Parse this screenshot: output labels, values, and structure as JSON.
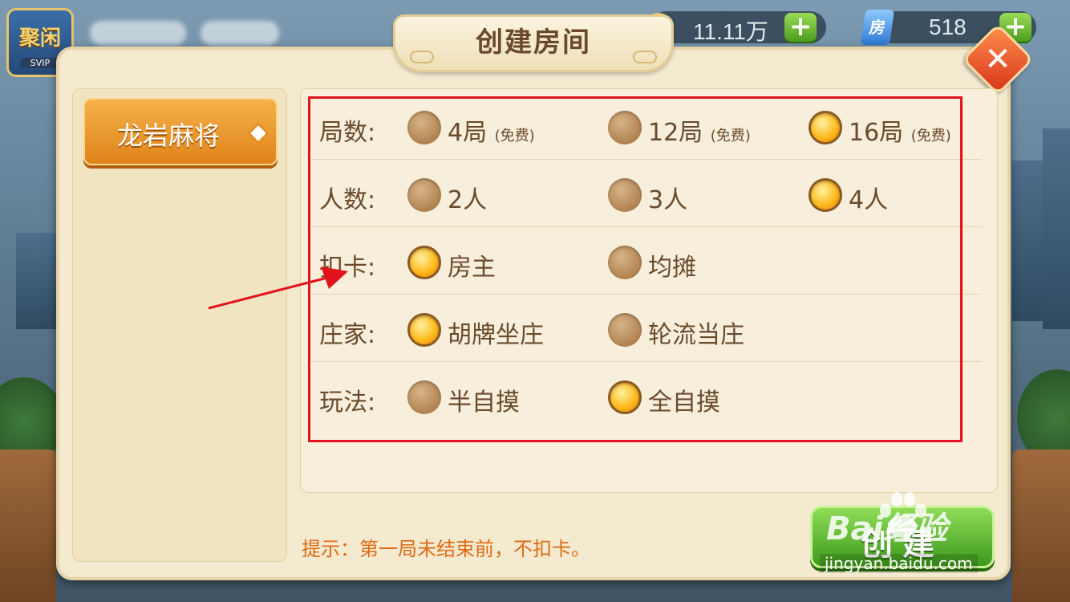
{
  "top_bar": {
    "logo_text": "聚闲",
    "logo_sub": "SVIP",
    "coins": "11.11万",
    "cards_icon_text": "房",
    "cards": "518",
    "plus_label": "+"
  },
  "dialog": {
    "title": "创建房间",
    "close_label": "✕"
  },
  "game_list": [
    {
      "label": "龙岩麻将",
      "selected": true
    }
  ],
  "rows": [
    {
      "label": "局数:",
      "options": [
        {
          "label": "4局",
          "note": "(免费)",
          "selected": false
        },
        {
          "label": "12局",
          "note": "(免费)",
          "selected": false
        },
        {
          "label": "16局",
          "note": "(免费)",
          "selected": true
        }
      ]
    },
    {
      "label": "人数:",
      "options": [
        {
          "label": "2人",
          "selected": false
        },
        {
          "label": "3人",
          "selected": false
        },
        {
          "label": "4人",
          "selected": true
        }
      ]
    },
    {
      "label": "扣卡:",
      "options": [
        {
          "label": "房主",
          "selected": true
        },
        {
          "label": "均摊",
          "selected": false
        }
      ]
    },
    {
      "label": "庄家:",
      "options": [
        {
          "label": "胡牌坐庄",
          "selected": true
        },
        {
          "label": "轮流当庄",
          "selected": false
        }
      ]
    },
    {
      "label": "玩法:",
      "options": [
        {
          "label": "半自摸",
          "selected": false
        },
        {
          "label": "全自摸",
          "selected": true
        }
      ]
    }
  ],
  "hint": "提示：第一局未结束前，不扣卡。",
  "create_button": "创建",
  "watermark": {
    "text": "Bai经验",
    "url": "jingyan.baidu.com"
  },
  "colors": {
    "highlight_box": "#e3131d",
    "annotation_arrow": "#e3131d",
    "radio_on": "#ffbb20",
    "hint": "#e06a14"
  }
}
